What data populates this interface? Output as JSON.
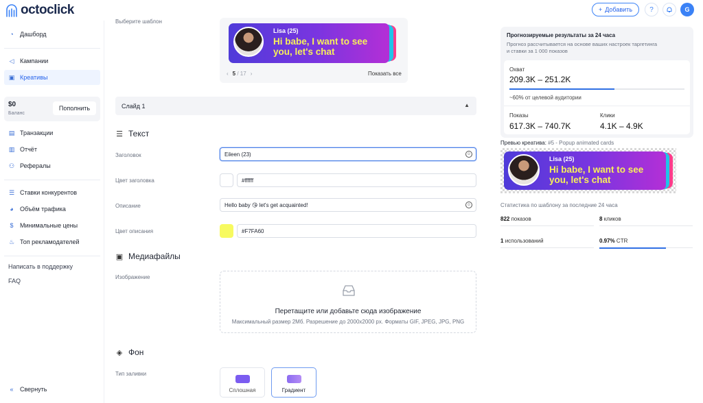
{
  "app": {
    "logo_text": "octoclick"
  },
  "header": {
    "add_label": "Добавить",
    "avatar_initial": "G"
  },
  "sidebar": {
    "items": [
      {
        "label": "Дашборд",
        "icon": "pie-chart-icon"
      },
      {
        "label": "Кампании",
        "icon": "megaphone-icon"
      },
      {
        "label": "Креативы",
        "icon": "image-icon",
        "active": true
      },
      {
        "label": "Транзакции",
        "icon": "transactions-icon"
      },
      {
        "label": "Отчёт",
        "icon": "report-icon"
      },
      {
        "label": "Рефералы",
        "icon": "referrals-icon"
      },
      {
        "label": "Ставки конкурентов",
        "icon": "list-icon"
      },
      {
        "label": "Объём трафика",
        "icon": "pie-icon"
      },
      {
        "label": "Минимальные цены",
        "icon": "coin-icon"
      },
      {
        "label": "Топ рекламодателей",
        "icon": "fire-icon"
      }
    ],
    "balance": {
      "value": "$0",
      "label": "Баланс",
      "topup_label": "Пополнить"
    },
    "support_link": "Написать в поддержку",
    "faq_link": "FAQ",
    "collapse_label": "Свернуть"
  },
  "template": {
    "label": "Выберите шаблон",
    "banner": {
      "name": "Lisa (25)",
      "message": "Hi babe, I want to see you, let's chat"
    },
    "pager": {
      "current": "5",
      "total": "/ 17"
    },
    "show_all": "Показать все"
  },
  "slide": {
    "title": "Слайд 1"
  },
  "text_section": {
    "heading": "Текст",
    "title_label": "Заголовок",
    "title_value": "Eileen (23)",
    "title_color_label": "Цвет заголовка",
    "title_color_value": "#ffffff",
    "title_color": "#ffffff",
    "desc_label": "Описание",
    "desc_value": "Hello baby 😘 let's get acquainted!",
    "desc_color_label": "Цвет описания",
    "desc_color_value": "#F7FA60",
    "desc_color": "#F7FA60"
  },
  "media_section": {
    "heading": "Медиафайлы",
    "image_label": "Изображение",
    "drop_title": "Перетащите или добавьте сюда изображение",
    "drop_sub": "Максимальный размер 2Мб. Разрешение до 2000x2000 px. Форматы GIF, JPEG, JPG, PNG"
  },
  "bg_section": {
    "heading": "Фон",
    "fill_label": "Тип заливки",
    "options": [
      {
        "label": "Сплошная",
        "color": "#7b5cf0"
      },
      {
        "label": "Градиент",
        "color": "#8c6cf0",
        "selected": true
      }
    ]
  },
  "forecast": {
    "title": "Прогнозируемые результаты за 24 часа",
    "subtitle": "Прогноз рассчитывается на основе ваших настроек таргетинга и ставки за 1 000 показов",
    "reach_label": "Охват",
    "reach_value": "209.3K – 251.2K",
    "reach_fraction": 0.6,
    "reach_note": "~60% от целевой аудитории",
    "impressions_label": "Показы",
    "impressions_value": "617.3K – 740.7K",
    "clicks_label": "Клики",
    "clicks_value": "4.1K – 4.9K"
  },
  "preview": {
    "title": "Превью креатива:",
    "template_name": "#5 - Popup animated cards",
    "banner": {
      "name": "Lisa (25)",
      "message": "Hi babe, I want to see you, let's chat"
    }
  },
  "stats": {
    "title": "Статистика по шаблону за последние 24 часа",
    "impressions_value": "822",
    "impressions_unit": "показов",
    "clicks_value": "8",
    "clicks_unit": "кликов",
    "uses_value": "1",
    "uses_unit": "использований",
    "ctr_value": "0.97%",
    "ctr_unit": "CTR",
    "ctr_fraction": 0.97
  },
  "colors": {
    "accent": "#2563eb",
    "banner_text": "#f7f05a"
  }
}
